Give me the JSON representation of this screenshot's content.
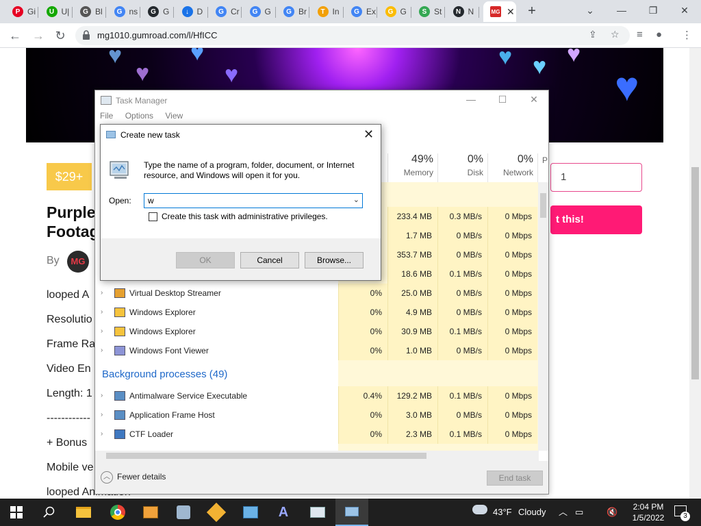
{
  "browser": {
    "tabs": [
      {
        "title": "Gi",
        "icon": "pinterest-icon",
        "color": "#e60023",
        "glyph": "P"
      },
      {
        "title": "U|",
        "icon": "upwork-icon",
        "color": "#14a800",
        "glyph": "U"
      },
      {
        "title": "Bl",
        "icon": "globe-icon",
        "color": "#555555",
        "glyph": "G"
      },
      {
        "title": "ns",
        "icon": "google-icon",
        "color": "#4285f4",
        "glyph": "G"
      },
      {
        "title": "G",
        "icon": "github-icon",
        "color": "#24292e",
        "glyph": "G"
      },
      {
        "title": "D",
        "icon": "download-icon",
        "color": "#1a73e8",
        "glyph": "↓"
      },
      {
        "title": "Cr",
        "icon": "google-icon",
        "color": "#4285f4",
        "glyph": "G"
      },
      {
        "title": "G",
        "icon": "google-icon",
        "color": "#4285f4",
        "glyph": "G"
      },
      {
        "title": "Br",
        "icon": "google-icon",
        "color": "#4285f4",
        "glyph": "G"
      },
      {
        "title": "In",
        "icon": "feather-icon",
        "color": "#f2a007",
        "glyph": "T"
      },
      {
        "title": "Ex",
        "icon": "google-icon",
        "color": "#4285f4",
        "glyph": "G"
      },
      {
        "title": "G",
        "icon": "google-photos-icon",
        "color": "#fbbc04",
        "glyph": "G"
      },
      {
        "title": "St",
        "icon": "sheets-icon",
        "color": "#34a853",
        "glyph": "S"
      },
      {
        "title": "N",
        "icon": "github-icon",
        "color": "#24292e",
        "glyph": "N"
      }
    ],
    "active_tab": {
      "icon": "mg-icon",
      "color": "#d62828",
      "glyph": "MG"
    },
    "url": "mg1010.gumroad.com/l/HfICC"
  },
  "page": {
    "price": "$29+",
    "title_line1": "Purple",
    "title_line2": "Footag",
    "by_label": "By",
    "avatar_text": "MG",
    "description_lines": [
      "looped A",
      "Resolutio",
      "Frame Ra",
      "Video En",
      "Length: 1",
      "------------",
      "+ Bonus",
      "Mobile ve",
      "looped Animation"
    ],
    "quantity": "1",
    "buy_label": "t this!"
  },
  "task_manager": {
    "title": "Task Manager",
    "menu": [
      "File",
      "Options",
      "View"
    ],
    "columns": [
      {
        "pct": "49%",
        "label": "Memory"
      },
      {
        "pct": "0%",
        "label": "Disk"
      },
      {
        "pct": "0%",
        "label": "Network"
      },
      {
        "pct": "",
        "label": "P"
      }
    ],
    "hidden_rows": [
      {
        "memory": "233.4 MB",
        "disk": "0.3 MB/s",
        "network": "0 Mbps"
      },
      {
        "memory": "1.7 MB",
        "disk": "0 MB/s",
        "network": "0 Mbps"
      },
      {
        "memory": "353.7 MB",
        "disk": "0 MB/s",
        "network": "0 Mbps"
      },
      {
        "memory": "18.6 MB",
        "disk": "0.1 MB/s",
        "network": "0 Mbps"
      }
    ],
    "app_rows": [
      {
        "name": "Virtual Desktop Streamer",
        "icon": "vds-icon",
        "cpu": "0%",
        "memory": "25.0 MB",
        "disk": "0 MB/s",
        "network": "0 Mbps"
      },
      {
        "name": "Windows Explorer",
        "icon": "folder-icon",
        "cpu": "0%",
        "memory": "4.9 MB",
        "disk": "0 MB/s",
        "network": "0 Mbps"
      },
      {
        "name": "Windows Explorer",
        "icon": "folder-icon",
        "cpu": "0%",
        "memory": "30.9 MB",
        "disk": "0.1 MB/s",
        "network": "0 Mbps"
      },
      {
        "name": "Windows Font Viewer",
        "icon": "font-viewer-icon",
        "cpu": "0%",
        "memory": "1.0 MB",
        "disk": "0 MB/s",
        "network": "0 Mbps"
      }
    ],
    "bg_section": "Background processes (49)",
    "bg_rows": [
      {
        "name": "Antimalware Service Executable",
        "icon": "service-icon",
        "cpu": "0.4%",
        "memory": "129.2 MB",
        "disk": "0.1 MB/s",
        "network": "0 Mbps"
      },
      {
        "name": "Application Frame Host",
        "icon": "service-icon",
        "cpu": "0%",
        "memory": "3.0 MB",
        "disk": "0 MB/s",
        "network": "0 Mbps"
      },
      {
        "name": "CTF Loader",
        "icon": "ctf-icon",
        "cpu": "0%",
        "memory": "2.3 MB",
        "disk": "0.1 MB/s",
        "network": "0 Mbps"
      }
    ],
    "fewer_details": "Fewer details",
    "end_task": "End task"
  },
  "run_dialog": {
    "title": "Create new task",
    "message": "Type the name of a program, folder, document, or Internet resource, and Windows will open it for you.",
    "open_label": "Open:",
    "open_value": "w",
    "admin_label": "Create this task with administrative privileges.",
    "ok": "OK",
    "cancel": "Cancel",
    "browse": "Browse..."
  },
  "taskbar": {
    "weather_temp": "43°F",
    "weather_text": "Cloudy",
    "time": "2:04 PM",
    "date": "1/5/2022",
    "notifications": "3"
  }
}
